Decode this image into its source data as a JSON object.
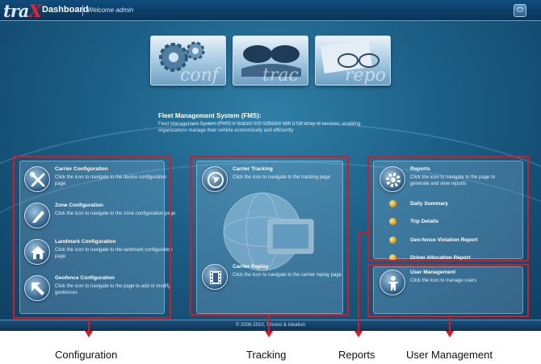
{
  "header": {
    "logo_prefix": "tra",
    "logo_x": "X",
    "title": "Dashboard",
    "welcome": "Welcome admin",
    "power_glyph": "⏻"
  },
  "thumbnails": [
    {
      "overlay": "conf",
      "icon": "gears-thumbnail"
    },
    {
      "overlay": "trac",
      "icon": "car-thumbnail"
    },
    {
      "overlay": "repo",
      "icon": "glasses-thumbnail"
    }
  ],
  "fms": {
    "title": "Fleet Management System (FMS):",
    "description": "Fleet Management System (FMS) is feature rich software with a full array of services; enabling organizations manage their vehicle economically and efficiently"
  },
  "configuration": {
    "items": [
      {
        "title": "Carrier Configuration",
        "desc": "Click the icon to navigate to the device configuration page",
        "icon": "tools-icon"
      },
      {
        "title": "Zone Configuration",
        "desc": "Click the icon to navigate to the zone configuration page",
        "icon": "pencil-icon"
      },
      {
        "title": "Landmark Configuration",
        "desc": "Click the icon to navigate to the landmark configuration page",
        "icon": "home-icon"
      },
      {
        "title": "Geofence Configuration",
        "desc": "Click the icon to navigate to the page to add or modify geofences",
        "icon": "arrow-up-left-icon"
      }
    ]
  },
  "tracking": {
    "items": [
      {
        "title": "Carrier Tracking",
        "desc": "Click the icon to navigate to the tracking page",
        "icon": "globe-icon"
      },
      {
        "title": "Carrier Replay",
        "desc": "Click the icon to navigate to the carrier replay page",
        "icon": "film-icon"
      }
    ]
  },
  "reports": {
    "title": "Reports",
    "desc": "Click the icon to navigate to the page to generate and view reports",
    "icon": "gear-icon",
    "sub_items": [
      "Daily Summary",
      "Trip Details",
      "Geo-fence Violation Report",
      "Driver Allocation Report"
    ]
  },
  "user_management": {
    "title": "User Management",
    "desc": "Click the icon to manage users",
    "icon": "user-icon"
  },
  "footer": "© 2008-2010, Timoco & Ideation",
  "annotations": {
    "configuration": "Configuration",
    "tracking": "Tracking",
    "reports": "Reports",
    "user_management": "User Management"
  },
  "colors": {
    "annotation_red": "#d41c22",
    "header_bg": "#0a3559",
    "logo_x": "#e0252c"
  }
}
